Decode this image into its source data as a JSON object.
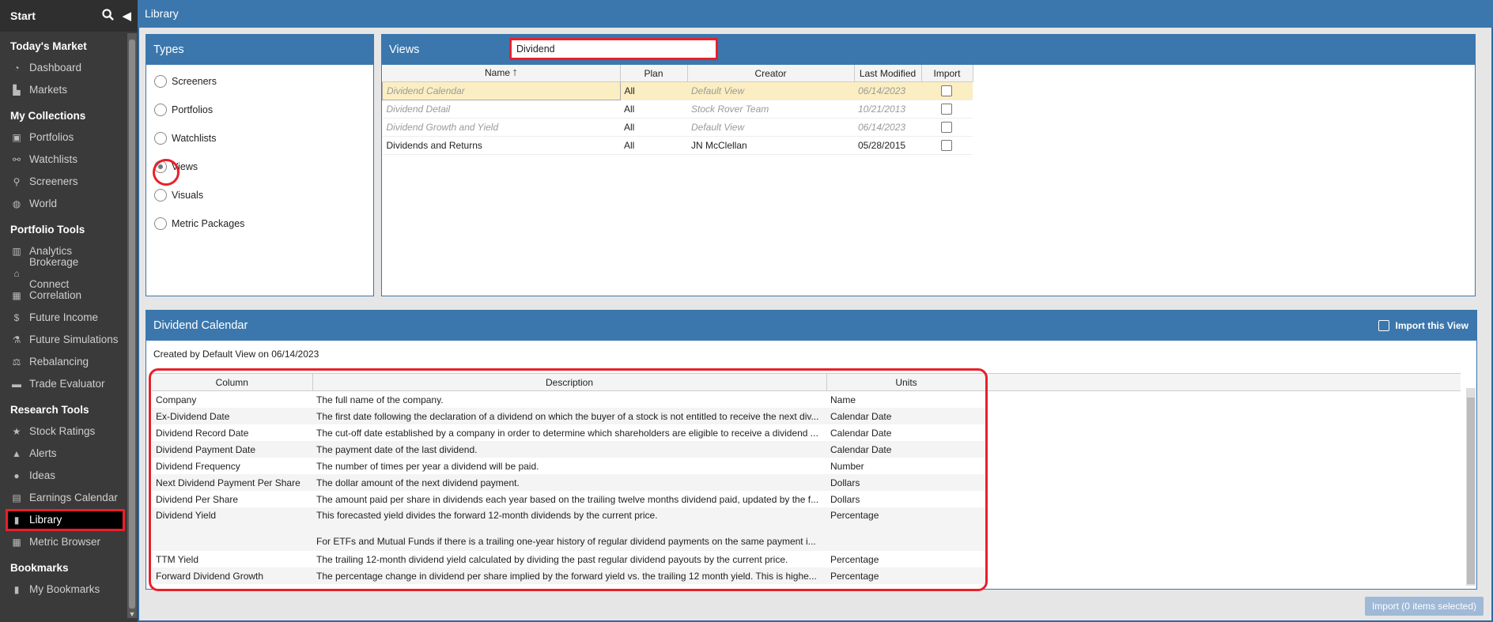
{
  "sidebar": {
    "start_label": "Start",
    "sections": [
      {
        "title": "Today's Market",
        "items": [
          {
            "label": "Dashboard",
            "icon": "dashboard-icon"
          },
          {
            "label": "Markets",
            "icon": "chart-icon"
          }
        ]
      },
      {
        "title": "My Collections",
        "items": [
          {
            "label": "Portfolios",
            "icon": "briefcase-icon"
          },
          {
            "label": "Watchlists",
            "icon": "binoculars-icon"
          },
          {
            "label": "Screeners",
            "icon": "search-icon"
          },
          {
            "label": "World",
            "icon": "globe-icon"
          }
        ]
      },
      {
        "title": "Portfolio Tools",
        "items": [
          {
            "label": "Analytics",
            "icon": "bar-chart-icon"
          },
          {
            "label": "Brokerage Connect",
            "icon": "bank-icon"
          },
          {
            "label": "Correlation",
            "icon": "grid-icon"
          },
          {
            "label": "Future Income",
            "icon": "dollar-icon"
          },
          {
            "label": "Future Simulations",
            "icon": "flask-icon"
          },
          {
            "label": "Rebalancing",
            "icon": "scale-icon"
          },
          {
            "label": "Trade Evaluator",
            "icon": "toolbox-icon"
          }
        ]
      },
      {
        "title": "Research Tools",
        "items": [
          {
            "label": "Stock Ratings",
            "icon": "star-icon"
          },
          {
            "label": "Alerts",
            "icon": "bell-icon"
          },
          {
            "label": "Ideas",
            "icon": "lightbulb-icon"
          },
          {
            "label": "Earnings Calendar",
            "icon": "calendar-icon"
          },
          {
            "label": "Library",
            "icon": "book-icon"
          },
          {
            "label": "Metric Browser",
            "icon": "table-icon"
          }
        ]
      },
      {
        "title": "Bookmarks",
        "items": [
          {
            "label": "My Bookmarks",
            "icon": "bookmark-icon"
          }
        ]
      }
    ]
  },
  "topbar": {
    "title": "Library"
  },
  "types": {
    "title": "Types",
    "options": [
      "Screeners",
      "Portfolios",
      "Watchlists",
      "Views",
      "Visuals",
      "Metric Packages"
    ],
    "selected": "Views"
  },
  "views": {
    "title": "Views",
    "search_value": "Dividend",
    "columns": [
      "Name",
      "Plan",
      "Creator",
      "Last Modified",
      "Import"
    ],
    "rows": [
      {
        "name": "Dividend Calendar",
        "plan": "All",
        "creator": "Default View",
        "modified": "06/14/2023",
        "muted": true,
        "selected": true
      },
      {
        "name": "Dividend Detail",
        "plan": "All",
        "creator": "Stock Rover Team",
        "modified": "10/21/2013",
        "muted": true,
        "selected": false
      },
      {
        "name": "Dividend Growth and Yield",
        "plan": "All",
        "creator": "Default View",
        "modified": "06/14/2023",
        "muted": true,
        "selected": false
      },
      {
        "name": "Dividends and Returns",
        "plan": "All",
        "creator": "JN McClellan",
        "modified": "05/28/2015",
        "muted": false,
        "selected": false
      }
    ]
  },
  "detail": {
    "title": "Dividend Calendar",
    "import_this_label": "Import this View",
    "created_by": "Created by Default View on 06/14/2023",
    "columns": [
      "Column",
      "Description",
      "Units"
    ],
    "rows": [
      {
        "column": "Company",
        "description": "The full name of the company.",
        "units": "Name"
      },
      {
        "column": "Ex-Dividend Date",
        "description": "The first date following the declaration of a dividend on which the buyer of a stock is not entitled to receive the next div...",
        "units": "Calendar Date"
      },
      {
        "column": "Dividend Record Date",
        "description": "The cut-off date established by a company in order to determine which shareholders are eligible to receive a dividend ...",
        "units": "Calendar Date"
      },
      {
        "column": "Dividend Payment Date",
        "description": "The payment date of the last dividend.",
        "units": "Calendar Date"
      },
      {
        "column": "Dividend Frequency",
        "description": "The number of times per year a dividend will be paid.",
        "units": "Number"
      },
      {
        "column": "Next Dividend Payment Per Share",
        "description": "The dollar amount of the next dividend payment.",
        "units": "Dollars"
      },
      {
        "column": "Dividend Per Share",
        "description": "The amount paid per share in dividends each year based on the trailing twelve months dividend paid, updated by the f...",
        "units": "Dollars"
      },
      {
        "column": "Dividend Yield",
        "description": "This forecasted yield divides the forward 12-month dividends by the current price.",
        "description2": "For ETFs and Mutual Funds if there is a trailing one-year history of regular dividend payments on the same payment i...",
        "units": "Percentage"
      },
      {
        "column": "TTM Yield",
        "description": "The trailing 12-month dividend yield calculated by dividing the past regular dividend payouts by the current price.",
        "units": "Percentage"
      },
      {
        "column": "Forward Dividend Growth",
        "description": "The percentage change in dividend per share implied by the forward yield vs. the trailing 12 month yield. This is highe...",
        "units": "Percentage"
      }
    ],
    "import_button_label": "Import (0 items selected)"
  }
}
